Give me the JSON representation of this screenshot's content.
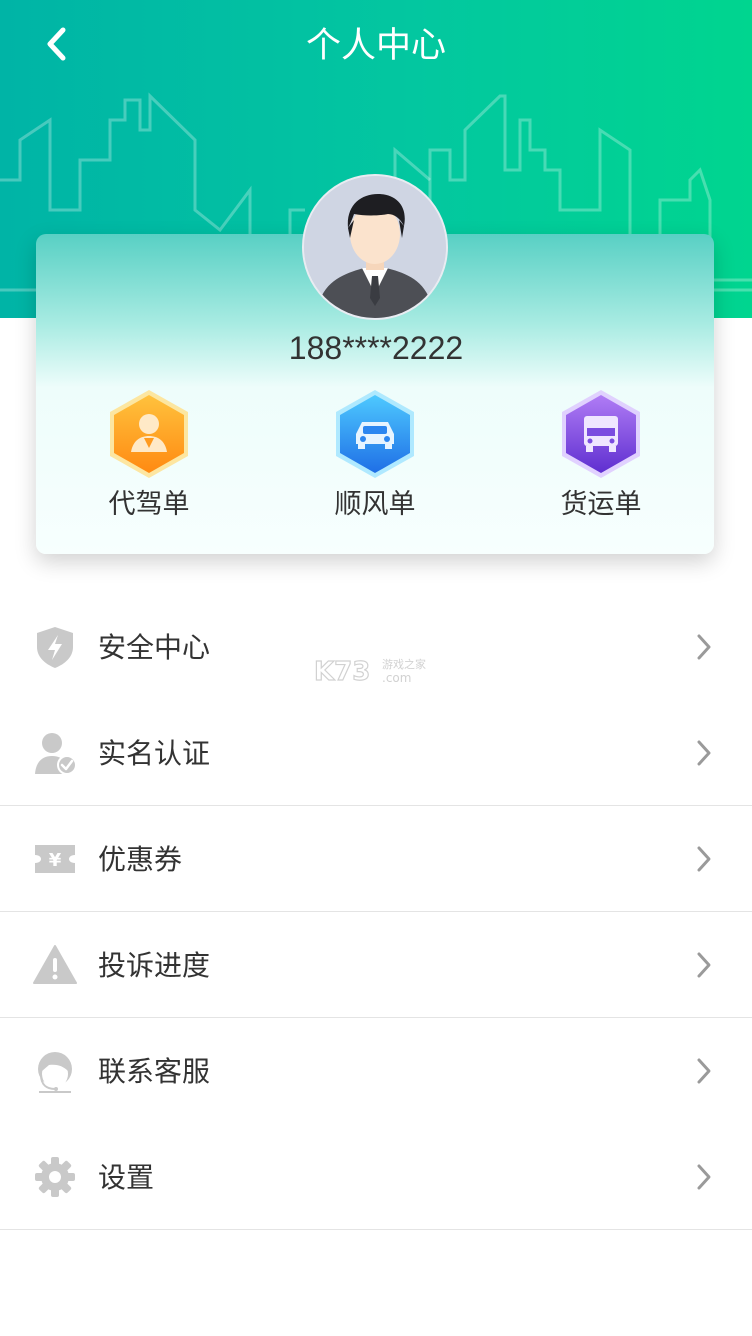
{
  "header": {
    "title": "个人中心",
    "back_icon": "chevron-left-icon",
    "gradient_start": "#00b4a6",
    "gradient_end": "#00d58f"
  },
  "profile": {
    "avatar_icon": "user-avatar-icon",
    "phone": "188****2222"
  },
  "orders": [
    {
      "label": "代驾单",
      "icon": "designated-driver-icon",
      "color": "#ff9a1e"
    },
    {
      "label": "顺风单",
      "icon": "car-icon",
      "color": "#2c86f0"
    },
    {
      "label": "货运单",
      "icon": "truck-icon",
      "color": "#7b4ce0"
    }
  ],
  "menu": [
    {
      "label": "安全中心",
      "icon": "shield-icon"
    },
    {
      "label": "实名认证",
      "icon": "verified-user-icon"
    },
    {
      "label": "优惠券",
      "icon": "coupon-icon"
    },
    {
      "label": "投诉进度",
      "icon": "warning-icon"
    },
    {
      "label": "联系客服",
      "icon": "customer-service-icon"
    },
    {
      "label": "设置",
      "icon": "gear-icon"
    }
  ],
  "watermark": {
    "brand": "K73",
    "sub": "游戏之家",
    "domain": ".com"
  }
}
